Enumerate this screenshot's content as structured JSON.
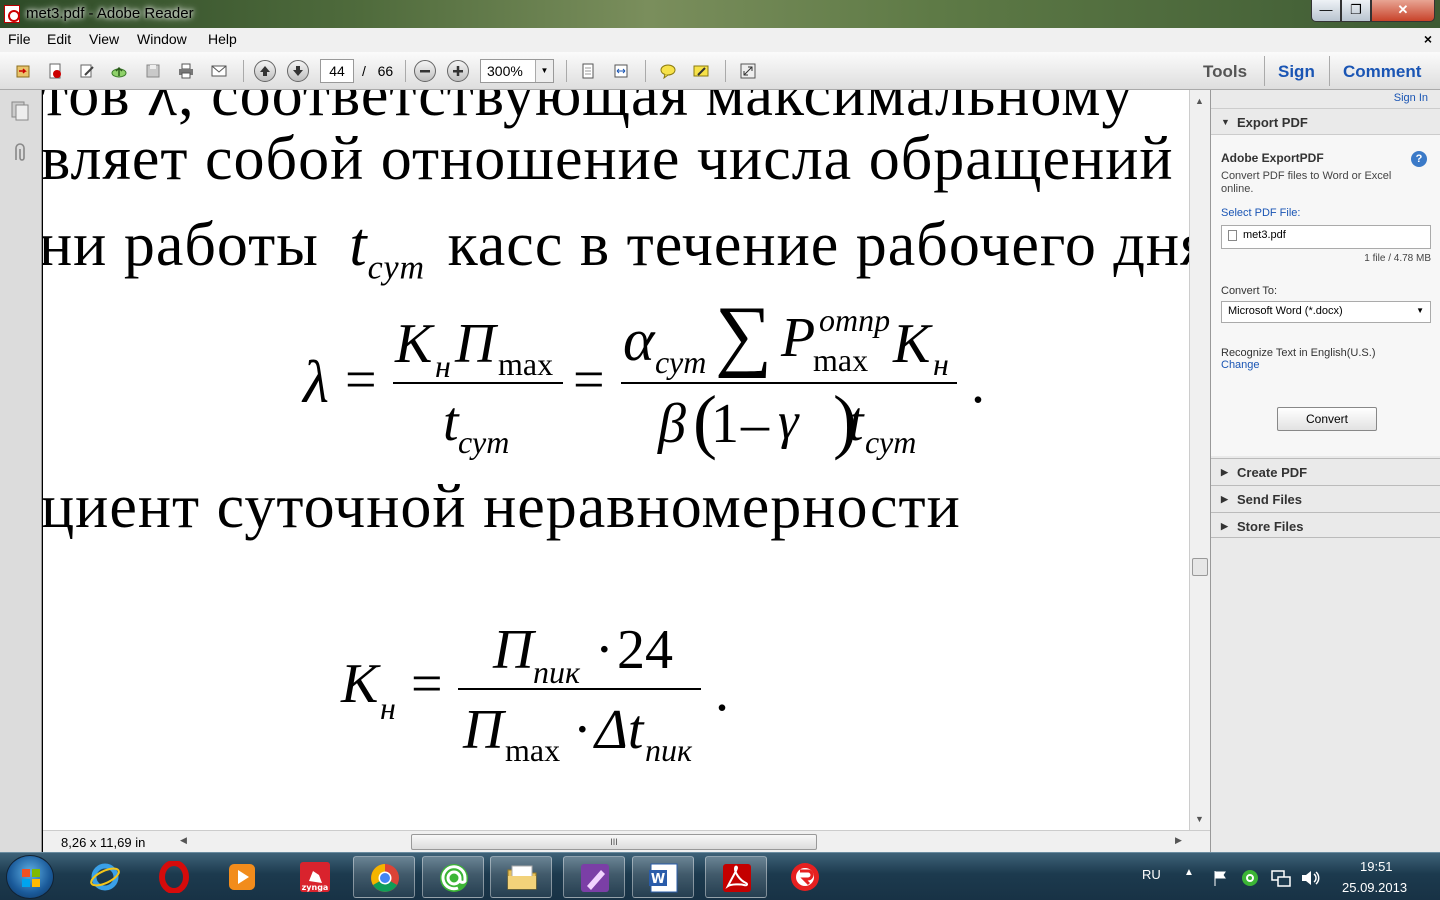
{
  "window": {
    "title": "met3.pdf - Adobe Reader",
    "close_symbol": "✕",
    "max_symbol": "❐",
    "min_symbol": "—"
  },
  "menu": {
    "items": [
      "File",
      "Edit",
      "View",
      "Window",
      "Help"
    ],
    "close_doc": "×"
  },
  "toolbar": {
    "current_page": "44",
    "page_separator": "/",
    "total_pages": "66",
    "zoom": "300%",
    "tools_label": "Tools",
    "sign_label": "Sign",
    "comment_label": "Comment"
  },
  "document": {
    "line1": "тов λ, соответствующая максимальному",
    "line2": "вляет собой отношение числа обращений",
    "line3_a": "ни работы",
    "line3_t": "t",
    "line3_sub": "сут",
    "line3_b": "касс в течение рабочего дня:",
    "formula1": {
      "lambda": "λ",
      "eq": "=",
      "K": "К",
      "Ksub": "н",
      "P": "П",
      "Psub": "max",
      "t": "t",
      "tsub": "сут",
      "alpha": "α",
      "alphasub": "сут",
      "sum": "∑",
      "P2": "P",
      "P2sup": "отпр",
      "P2sub": "max",
      "K2": "К",
      "K2sub": "н",
      "beta": "β",
      "lparen": "(",
      "one": "1",
      "minus": "–",
      "gamma": "γ",
      "rparen": ")",
      "t2": "t",
      "t2sub": "сут",
      "dot": "."
    },
    "line4": "циент суточной неравномерности",
    "formula2": {
      "K": "К",
      "Ksub": "н",
      "eq": "=",
      "P": "П",
      "Psub": "пик",
      "mul": "·",
      "num": "24",
      "P2": "П",
      "P2sub": "max",
      "mul2": "·",
      "dt": "Δt",
      "dtsub": "пик",
      "dot": "."
    }
  },
  "status": {
    "page_size": "8,26 x 11,69 in",
    "scroll_grip": "III"
  },
  "right_pane": {
    "sign_in": "Sign In",
    "export_header": "Export PDF",
    "export_title": "Adobe ExportPDF",
    "export_desc": "Convert PDF files to Word or Excel online.",
    "select_label": "Select PDF File:",
    "file_name": "met3.pdf",
    "file_info": "1 file / 4.78 MB",
    "convert_to_label": "Convert To:",
    "convert_to_value": "Microsoft Word (*.docx)",
    "recognize_text": "Recognize Text in English(U.S.)",
    "change_link": "Change",
    "convert_button": "Convert",
    "create_pdf": "Create PDF",
    "send_files": "Send Files",
    "store_files": "Store Files",
    "help": "?"
  },
  "taskbar": {
    "apps": [
      "internet-explorer",
      "opera",
      "media-player",
      "zynga",
      "chrome",
      "mail-agent",
      "file-explorer",
      "onenote",
      "word",
      "adobe-reader",
      "antivirus"
    ],
    "zynga_label": "zynga",
    "language": "RU",
    "time": "19:51",
    "date": "25.09.2013"
  },
  "colors": {
    "accent": "#1a55b4",
    "pdf_red": "#c40000",
    "taskbar": "#1c3a4e"
  }
}
